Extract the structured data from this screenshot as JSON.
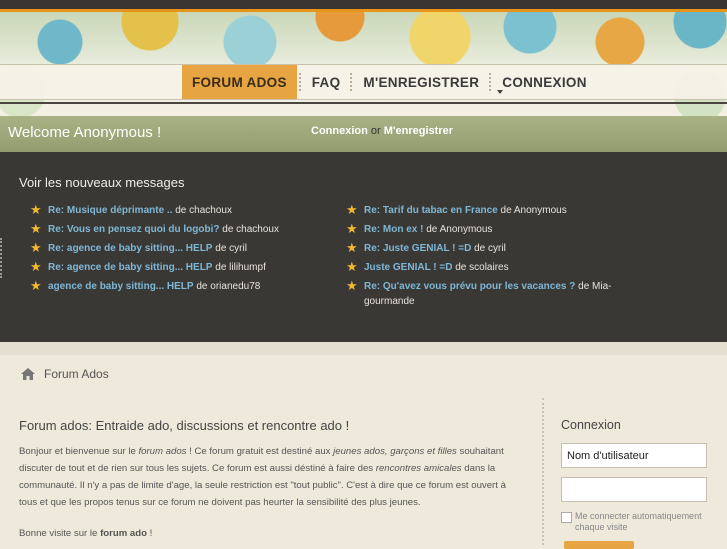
{
  "nav": {
    "items": [
      "FORUM ADOS",
      "FAQ",
      "M'ENREGISTRER",
      "CONNEXION"
    ]
  },
  "welcome": {
    "text": "Welcome Anonymous !",
    "login_link": "Connexion",
    "or": "or",
    "register_link": "M'enregistrer"
  },
  "news": {
    "title": "Voir les nouveaux messages",
    "left": [
      {
        "link": "Re: Musique déprimante ..",
        "by": "de chachoux"
      },
      {
        "link": "Re: Vous en pensez quoi du logobi?",
        "by": "de chachoux"
      },
      {
        "link": "Re: agence de baby sitting... HELP",
        "by": "de cyril"
      },
      {
        "link": "Re: agence de baby sitting... HELP",
        "by": "de lilihumpf"
      },
      {
        "link": "agence de baby sitting... HELP",
        "by": "de orianedu78"
      }
    ],
    "right": [
      {
        "link": "Re: Tarif du tabac en France",
        "by": "de Anonymous"
      },
      {
        "link": "Re: Mon ex !",
        "by": "de Anonymous"
      },
      {
        "link": "Re: Juste GENIAL ! =D",
        "by": "de cyril"
      },
      {
        "link": "Juste GENIAL ! =D",
        "by": "de scolaires"
      },
      {
        "link": "Re: Qu'avez vous prévu pour les vacances ?",
        "by": "de Mia-gourmande"
      }
    ]
  },
  "breadcrumb": {
    "label": "Forum Ados"
  },
  "main": {
    "title": "Forum ados: Entraide ado, discussions et rencontre ado !",
    "p1_a": "Bonjour et bienvenue sur le ",
    "p1_b": "forum ados",
    "p1_c": " ! Ce forum gratuit est destiné aux ",
    "p1_d": "jeunes ados, garçons et filles",
    "p1_e": " souhaitant discuter de tout et de rien sur tous les sujets. Ce forum est aussi déstiné à faire des ",
    "p1_f": "rencontres amicales",
    "p1_g": " dans la communauté. Il n'y a pas de limite d'age, la seule restriction est \"tout public\". C'est à dire que ce forum est ouvert à tous et que les propos tenus sur ce forum ne doivent pas heurter la sensibilité des plus jeunes.",
    "p2_a": "Bonne visite sur le ",
    "p2_b": "forum ado",
    "p2_c": " !"
  },
  "login": {
    "title": "Connexion",
    "username_placeholder": "Nom d'utilisateur",
    "password_placeholder": "",
    "remember": "Me connecter automatiquement chaque visite"
  }
}
